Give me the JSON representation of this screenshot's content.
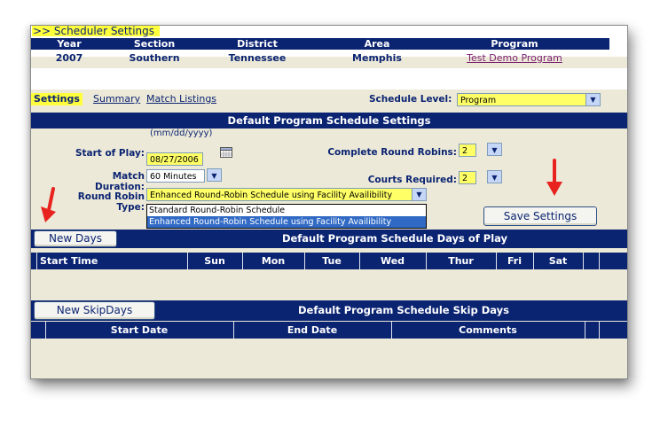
{
  "breadcrumb": ">> Scheduler Settings",
  "header": {
    "columns": [
      "Year",
      "Section",
      "District",
      "Area",
      "Program"
    ],
    "values": [
      "2007",
      "Southern",
      "Tennessee",
      "Memphis",
      "Test Demo Program"
    ]
  },
  "tabs": [
    "Settings",
    "Summary",
    "Match Listings"
  ],
  "schedule_level": {
    "label": "Schedule Level:",
    "value": "Program"
  },
  "settings_section": {
    "title": "Default Program Schedule Settings",
    "date_hint": "(mm/dd/yyyy)",
    "start_of_play_label": "Start of Play:",
    "start_of_play_value": "08/27/2006",
    "match_duration_label": "Match Duration:",
    "match_duration_value": "60 Minutes",
    "round_robin_type_label": "Round Robin Type:",
    "round_robin_type_value": "Enhanced Round-Robin Schedule using Facility Availibility",
    "round_robin_options": [
      "Standard Round-Robin Schedule",
      "Enhanced Round-Robin Schedule using Facility Availibility"
    ],
    "complete_round_robins_label": "Complete Round Robins:",
    "complete_round_robins_value": "2",
    "courts_required_label": "Courts Required:",
    "courts_required_value": "2",
    "save_button": "Save Settings"
  },
  "days_section": {
    "button": "New Days",
    "title": "Default Program Schedule Days of Play",
    "columns": [
      "Start Time",
      "Sun",
      "Mon",
      "Tue",
      "Wed",
      "Thur",
      "Fri",
      "Sat"
    ]
  },
  "skip_section": {
    "button": "New SkipDays",
    "title": "Default Program Schedule Skip Days",
    "columns": [
      "Start Date",
      "End Date",
      "Comments"
    ]
  },
  "colors": {
    "navy": "#0b2472",
    "highlight": "#ffff3c",
    "panel": "#ece9d8",
    "arrow": "#e8231f"
  }
}
